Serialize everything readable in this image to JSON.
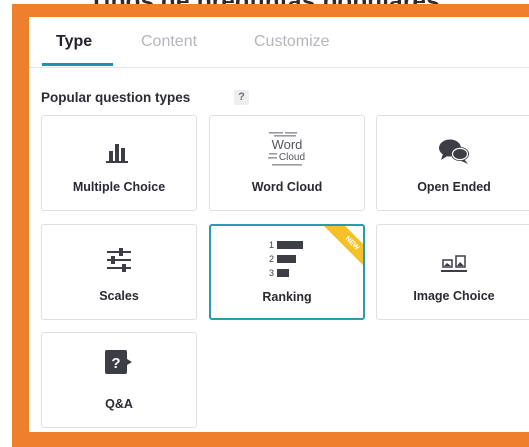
{
  "banner": {
    "title": "Tipos de preguntas populares"
  },
  "tabs": [
    {
      "label": "Type",
      "active": true
    },
    {
      "label": "Content",
      "active": false
    },
    {
      "label": "Customize",
      "active": false
    }
  ],
  "section": {
    "label": "Popular question types",
    "help": "?"
  },
  "cards": [
    {
      "label": "Multiple Choice",
      "icon": "bar-chart-icon"
    },
    {
      "label": "Word Cloud",
      "icon": "word-cloud-icon",
      "icon_text": {
        "main": "Word",
        "sub": "Cloud"
      }
    },
    {
      "label": "Open Ended",
      "icon": "speech-bubbles-icon"
    },
    {
      "label": "Scales",
      "icon": "sliders-icon"
    },
    {
      "label": "Ranking",
      "icon": "ranking-icon",
      "selected": true,
      "badge": "NEW",
      "ranks": [
        "1",
        "2",
        "3"
      ]
    },
    {
      "label": "Image Choice",
      "icon": "image-choice-icon"
    },
    {
      "label": "Q&A",
      "icon": "qa-icon",
      "icon_text": "?"
    }
  ],
  "colors": {
    "frame": "#ee7f2d",
    "accent": "#1a94a8",
    "selected_border": "#2a9bad",
    "badge": "#f5c12a",
    "icon": "#3d3d45"
  }
}
